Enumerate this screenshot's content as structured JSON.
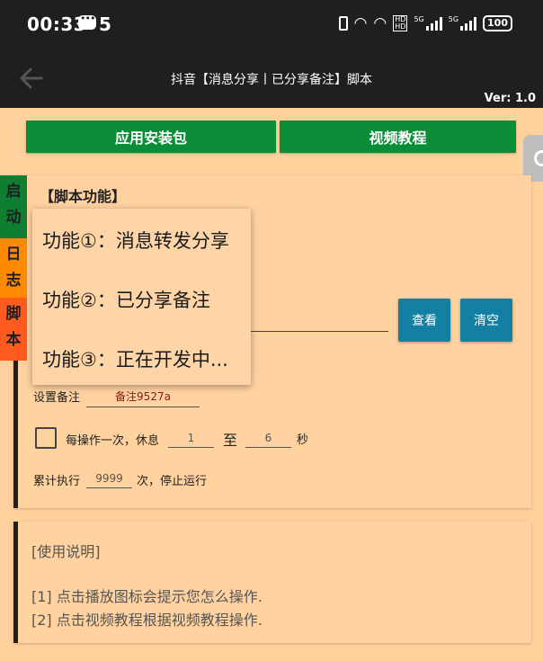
{
  "status_bar": {
    "time": "00:33",
    "notification_count": "5",
    "network": "5G",
    "battery": "100"
  },
  "app_bar": {
    "title": "抖音【消息分享丨已分享备注】脚本",
    "version": "Ver: 1.0"
  },
  "top_buttons": {
    "install_package": "应用安装包",
    "video_tutorial": "视频教程"
  },
  "side_tabs": {
    "start": "启动",
    "log": "日志",
    "script": "脚本"
  },
  "script_card": {
    "title": "【脚本功能】",
    "view_button": "查看",
    "clear_button": "清空",
    "remark_label": "设置备注",
    "remark_value": "备注9527a",
    "rest_label": "每操作一次，休息",
    "rest_min": "1",
    "to_label": "至",
    "rest_max": "6",
    "seconds_label": "秒",
    "total_label": "累计执行",
    "total_value": "9999",
    "stop_label": "次，停止运行"
  },
  "popup_menu": {
    "items": [
      "功能①：消息转发分享",
      "功能②：已分享备注",
      "功能③：正在开发中..."
    ]
  },
  "usage_card": {
    "title": "[使用说明]",
    "lines": [
      "[1] 点击播放图标会提示您怎么操作.",
      "[2] 点击视频教程根据视频教程操作."
    ]
  },
  "colors": {
    "background": "#ffd19d",
    "appbar": "#1f1f1f",
    "green": "#0b8c37",
    "blue": "#137fa3",
    "tab_start": "#0f7e33",
    "tab_log": "#ff8a00",
    "tab_script": "#ff5a1f"
  }
}
